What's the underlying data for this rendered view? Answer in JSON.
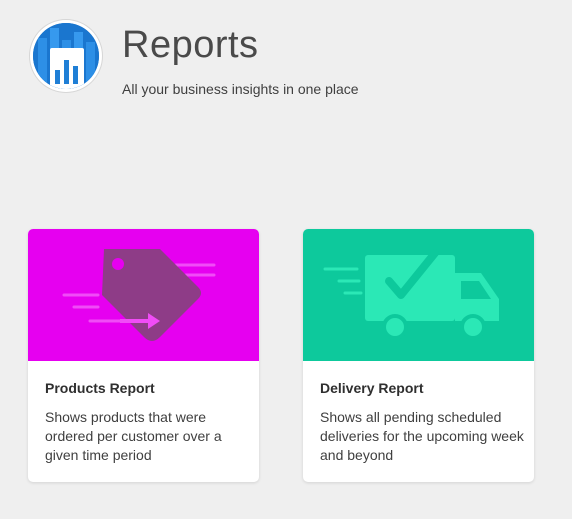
{
  "header": {
    "title": "Reports",
    "subtitle": "All your business insights in one place",
    "logo_icon": "bar-chart-icon"
  },
  "cards": [
    {
      "title": "Products Report",
      "description": "Shows products that were ordered per customer over a given time period",
      "icon": "fast-price-tag-icon",
      "banner_color": "#e600f0"
    },
    {
      "title": "Delivery Report",
      "description": "Shows all pending scheduled deliveries for the upcoming week and beyond",
      "icon": "delivery-truck-check-icon",
      "banner_color": "#0dc99c"
    }
  ]
}
